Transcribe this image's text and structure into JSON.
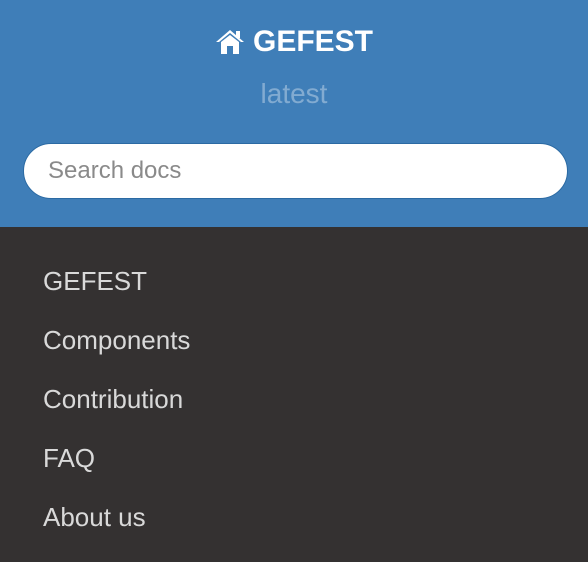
{
  "header": {
    "brand": "GEFEST",
    "home_icon": "home-icon",
    "version": "latest",
    "background_color": "#3f7eb8"
  },
  "search": {
    "placeholder": "Search docs",
    "value": ""
  },
  "menu": {
    "items": [
      {
        "label": "GEFEST"
      },
      {
        "label": "Components"
      },
      {
        "label": "Contribution"
      },
      {
        "label": "FAQ"
      },
      {
        "label": "About us"
      }
    ],
    "background_color": "#343131"
  }
}
